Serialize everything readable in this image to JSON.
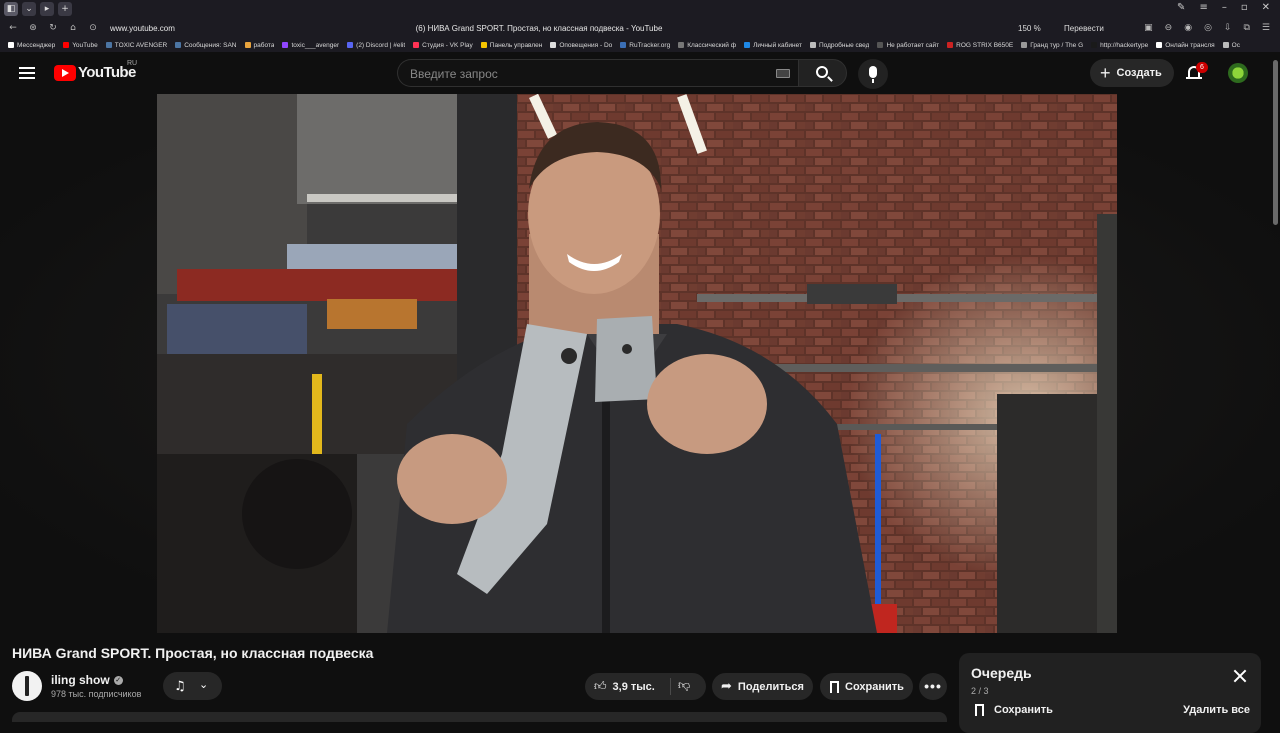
{
  "browser": {
    "url": "www.youtube.com",
    "page_title": "(6) НИВА Grand SPORT. Простая, но классная подвеска - YouTube",
    "zoom": "150 %",
    "translate_label": "Перевести",
    "bookmarks": [
      {
        "label": "Мессенджер",
        "color": "#ffffff"
      },
      {
        "label": "YouTube",
        "color": "#ff0000"
      },
      {
        "label": "TOXIC AVENGER",
        "color": "#4c75a3"
      },
      {
        "label": "Сообщения: SAN",
        "color": "#4c75a3"
      },
      {
        "label": "работа",
        "color": "#e8a33d"
      },
      {
        "label": "toxic___avenger",
        "color": "#9146ff"
      },
      {
        "label": "(2) Discord | #elit",
        "color": "#5865f2"
      },
      {
        "label": "Студия - VK Play",
        "color": "#ff3355"
      },
      {
        "label": "Панель управлен",
        "color": "#f5c400"
      },
      {
        "label": "Оповещения - Do",
        "color": "#dddddd"
      },
      {
        "label": "RuTracker.org",
        "color": "#3b6fb6"
      },
      {
        "label": "Классический ф",
        "color": "#777777"
      },
      {
        "label": "Личный кабинет",
        "color": "#1e88e5"
      },
      {
        "label": "Подробные свед",
        "color": "#bbbbbb"
      },
      {
        "label": "Не работает сайт",
        "color": "#555555"
      },
      {
        "label": "ROG STRIX B650E",
        "color": "#cc2222"
      },
      {
        "label": "Гранд тур / The G",
        "color": "#999999"
      },
      {
        "label": "http://hackertype",
        "color": "#1a1a1a"
      },
      {
        "label": "Онлайн трансля",
        "color": "#ffffff"
      },
      {
        "label": "Ос",
        "color": "#bbbbbb"
      }
    ]
  },
  "header": {
    "logo_text": "YouTube",
    "country_code": "RU",
    "search_placeholder": "Введите запрос",
    "create_label": "Создать",
    "notification_count": "6"
  },
  "video": {
    "title": "НИВА Grand SPORT. Простая, но классная подвеска",
    "channel_name": "iling show",
    "subscribers": "978 тыс. подписчиков",
    "likes": "3,9 тыс.",
    "share_label": "Поделиться",
    "save_label": "Сохранить",
    "more_label": "•••"
  },
  "queue": {
    "title": "Очередь",
    "position": "2 / 3",
    "save_label": "Сохранить",
    "clear_label": "Удалить все"
  },
  "colors": {
    "brand_red": "#ff0000",
    "badge_red": "#cc0000",
    "background": "#0f0f0f",
    "button_bg": "#272727"
  }
}
